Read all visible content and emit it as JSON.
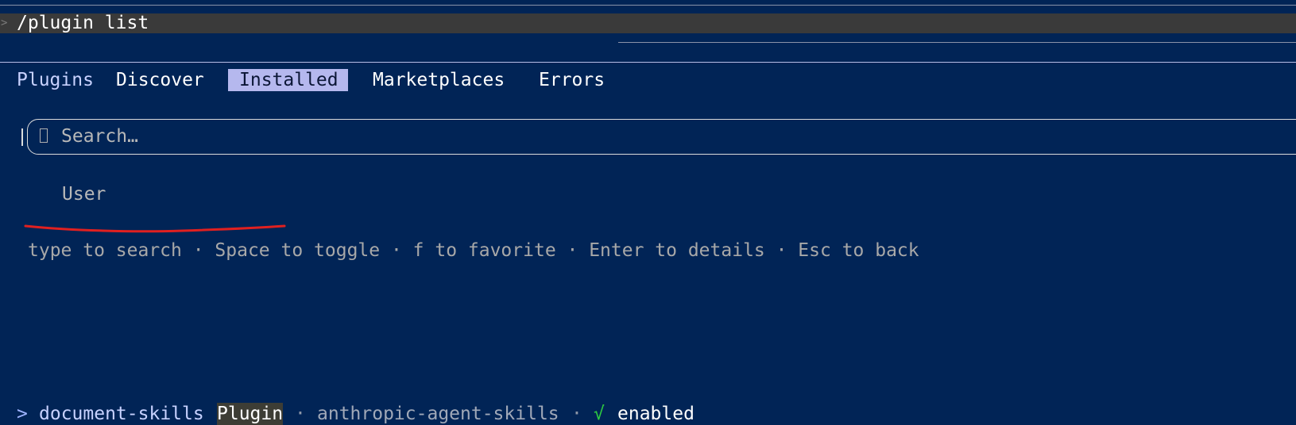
{
  "prompt": {
    "glyph": ">",
    "command": "/plugin list"
  },
  "tabs": {
    "title": "Plugins",
    "items": [
      "Discover",
      "Installed",
      "Marketplaces",
      "Errors"
    ],
    "active": "Installed"
  },
  "search": {
    "icon": "search-icon",
    "placeholder": "Search…"
  },
  "list": {
    "section": "User",
    "items": [
      {
        "caret": ">",
        "name": "document-skills",
        "badge": "Plugin",
        "separator1": "·",
        "marketplace": "anthropic-agent-skills",
        "separator2": "·",
        "check": "√",
        "status": "enabled"
      }
    ]
  },
  "help": "type to search · Space to toggle · f to favorite · Enter to details · Esc to back",
  "colors": {
    "background": "#012456",
    "active_tab": "#b5b8ee",
    "check": "#2ecc40",
    "annotation": "#e02020"
  }
}
